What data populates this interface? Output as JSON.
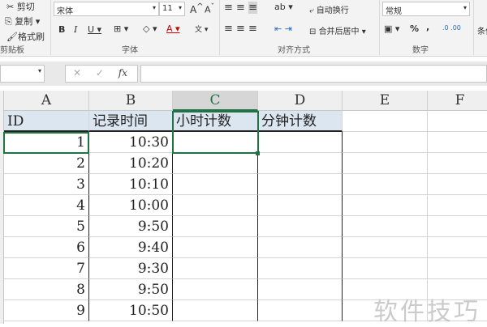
{
  "ribbon": {
    "clipboard": {
      "cut": "剪切",
      "copy": "复制",
      "format_painter": "格式刷",
      "group": "剪贴板"
    },
    "font": {
      "name": "宋体",
      "size": "11",
      "group": "字体"
    },
    "alignment": {
      "wrap": "自动换行",
      "merge": "合并后居中",
      "group": "对齐方式"
    },
    "number": {
      "format": "常规",
      "percent": "%",
      "comma": ",",
      "group": "数字"
    },
    "styles": {
      "cond": "条件"
    }
  },
  "formula_bar": {
    "fx": "fx",
    "value": ""
  },
  "columns": [
    "A",
    "B",
    "C",
    "D",
    "E",
    "F"
  ],
  "selected_column": "C",
  "headers": [
    "ID",
    "记录时间",
    "小时计数",
    "分钟计数"
  ],
  "rows": [
    {
      "id": "1",
      "time": "10:30"
    },
    {
      "id": "2",
      "time": "10:20"
    },
    {
      "id": "3",
      "time": "10:10"
    },
    {
      "id": "4",
      "time": "10:00"
    },
    {
      "id": "5",
      "time": "9:50"
    },
    {
      "id": "6",
      "time": "9:40"
    },
    {
      "id": "7",
      "time": "9:30"
    },
    {
      "id": "8",
      "time": "9:50"
    },
    {
      "id": "9",
      "time": "10:50"
    }
  ],
  "watermark": "软件技巧"
}
